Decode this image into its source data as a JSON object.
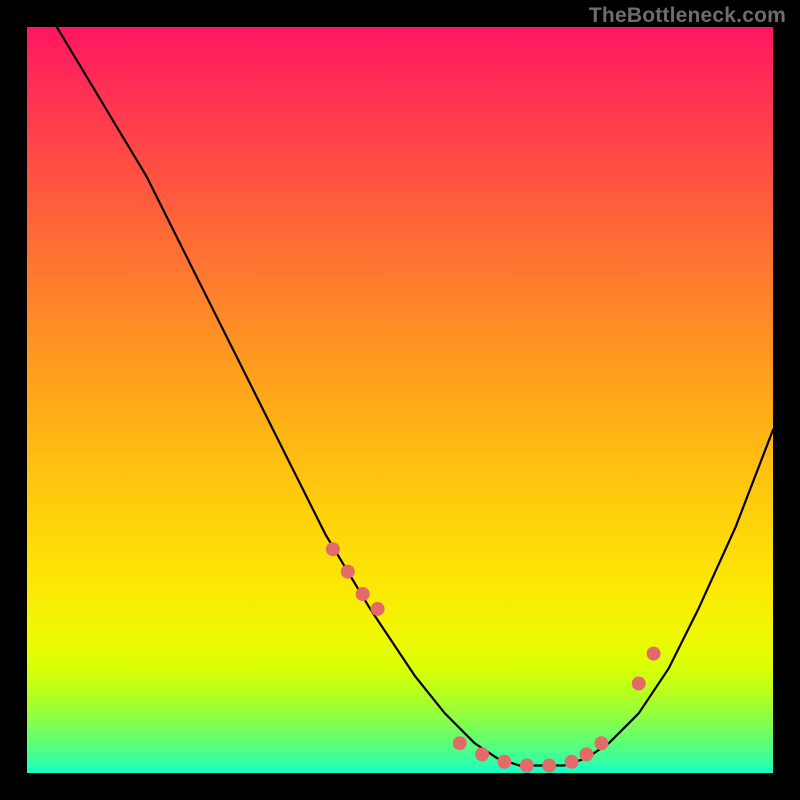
{
  "watermark": "TheBottleneck.com",
  "chart_data": {
    "type": "line",
    "title": "",
    "xlabel": "",
    "ylabel": "",
    "xlim": [
      0,
      100
    ],
    "ylim": [
      0,
      100
    ],
    "series": [
      {
        "name": "bottleneck-curve",
        "x": [
          4,
          10,
          16,
          22,
          28,
          34,
          40,
          46,
          52,
          56,
          60,
          63,
          66,
          69,
          72,
          75,
          78,
          82,
          86,
          90,
          95,
          100
        ],
        "y": [
          100,
          90,
          80,
          68,
          56,
          44,
          32,
          22,
          13,
          8,
          4,
          2,
          1,
          1,
          1,
          2,
          4,
          8,
          14,
          22,
          33,
          46
        ]
      }
    ],
    "markers": {
      "name": "highlight-dots",
      "x": [
        41,
        43,
        45,
        47,
        58,
        61,
        64,
        67,
        70,
        73,
        75,
        77,
        82,
        84
      ],
      "y": [
        30,
        27,
        24,
        22,
        4,
        2.5,
        1.5,
        1,
        1,
        1.5,
        2.5,
        4,
        12,
        16
      ]
    },
    "colors": {
      "curve": "#000000",
      "marker": "#e46a6a",
      "gradient_top": "#ff1661",
      "gradient_bottom": "#14ffcb"
    }
  }
}
